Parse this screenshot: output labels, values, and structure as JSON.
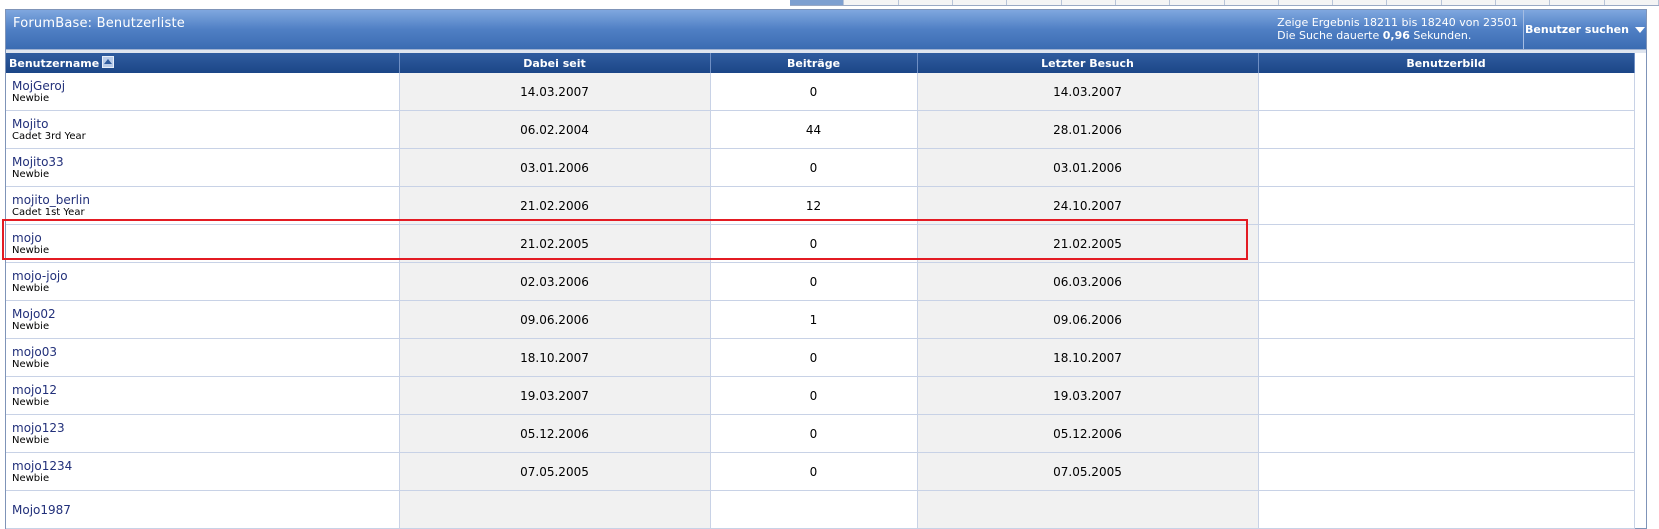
{
  "window": {
    "title": "ForumBase: Benutzerliste",
    "result_line1": "Zeige Ergebnis 18211 bis 18240 von 23501",
    "result_line2_prefix": "Die Suche dauerte ",
    "result_line2_time": "0,96",
    "result_line2_suffix": " Sekunden.",
    "search_button": "Benutzer suchen",
    "search_icon": "chevron-down-icon"
  },
  "table": {
    "headers": {
      "username": "Benutzername",
      "joined": "Dabei seit",
      "posts": "Beiträge",
      "last_visit": "Letzter Besuch",
      "avatar": "Benutzerbild"
    },
    "sort_icon": "sort-ascending-icon",
    "rows": [
      {
        "name": "MojGeroj",
        "rank": "Newbie",
        "joined": "14.03.2007",
        "posts": "0",
        "last": "14.03.2007"
      },
      {
        "name": "Mojito",
        "rank": "Cadet 3rd Year",
        "joined": "06.02.2004",
        "posts": "44",
        "last": "28.01.2006"
      },
      {
        "name": "Mojito33",
        "rank": "Newbie",
        "joined": "03.01.2006",
        "posts": "0",
        "last": "03.01.2006"
      },
      {
        "name": "mojito_berlin",
        "rank": "Cadet 1st Year",
        "joined": "21.02.2006",
        "posts": "12",
        "last": "24.10.2007"
      },
      {
        "name": "mojo",
        "rank": "Newbie",
        "joined": "21.02.2005",
        "posts": "0",
        "last": "21.02.2005"
      },
      {
        "name": "mojo-jojo",
        "rank": "Newbie",
        "joined": "02.03.2006",
        "posts": "0",
        "last": "06.03.2006"
      },
      {
        "name": "Mojo02",
        "rank": "Newbie",
        "joined": "09.06.2006",
        "posts": "1",
        "last": "09.06.2006"
      },
      {
        "name": "mojo03",
        "rank": "Newbie",
        "joined": "18.10.2007",
        "posts": "0",
        "last": "18.10.2007"
      },
      {
        "name": "mojo12",
        "rank": "Newbie",
        "joined": "19.03.2007",
        "posts": "0",
        "last": "19.03.2007"
      },
      {
        "name": "mojo123",
        "rank": "Newbie",
        "joined": "05.12.2006",
        "posts": "0",
        "last": "05.12.2006"
      },
      {
        "name": "mojo1234",
        "rank": "Newbie",
        "joined": "07.05.2005",
        "posts": "0",
        "last": "07.05.2005"
      },
      {
        "name": "Mojo1987",
        "rank": "",
        "joined": "",
        "posts": "",
        "last": ""
      }
    ],
    "highlighted_row": "mojo"
  },
  "colors": {
    "header_blue": "#3b6cb2",
    "highlight_red": "#e31b23",
    "link_blue": "#22307a"
  }
}
